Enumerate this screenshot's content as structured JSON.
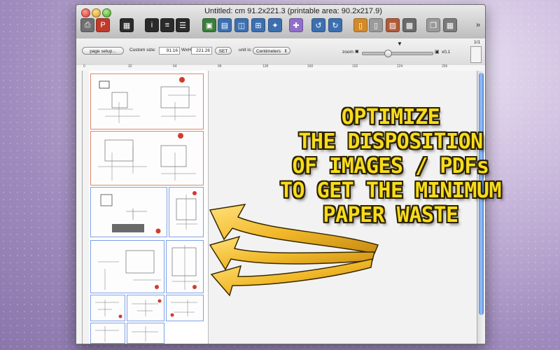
{
  "window": {
    "title": "Untitled: cm  91.2x221.3 (printable area: 90.2x217.9)",
    "page_counter": "1/1",
    "overflow": "»"
  },
  "toolbar": {
    "icons": [
      {
        "name": "print-icon",
        "glyph": "⎙",
        "color": "#6f6f6f"
      },
      {
        "name": "pdf-icon",
        "glyph": "P",
        "color": "#c0392b"
      },
      {
        "name": "grid-icon",
        "glyph": "▦",
        "color": "#2b2b2b"
      },
      {
        "name": "info-icon",
        "glyph": "i",
        "color": "#2a2a2a"
      },
      {
        "name": "sliders-icon",
        "glyph": "≡",
        "color": "#2a2a2a"
      },
      {
        "name": "list-icon",
        "glyph": "☰",
        "color": "#2a2a2a"
      },
      {
        "name": "image-add-icon",
        "glyph": "▣",
        "color": "#3b7d3a"
      },
      {
        "name": "image-icon",
        "glyph": "▤",
        "color": "#3c6fb0"
      },
      {
        "name": "window-icon",
        "glyph": "◫",
        "color": "#3c6fb0"
      },
      {
        "name": "arrange-icon",
        "glyph": "⊞",
        "color": "#3c6fb0"
      },
      {
        "name": "magic-icon",
        "glyph": "✦",
        "color": "#3c6fb0"
      },
      {
        "name": "stamp-icon",
        "glyph": "✚",
        "color": "#8f6fc9"
      },
      {
        "name": "rotate-left-icon",
        "glyph": "↺",
        "color": "#3c6fb0"
      },
      {
        "name": "rotate-right-icon",
        "glyph": "↻",
        "color": "#3c6fb0"
      },
      {
        "name": "document-icon",
        "glyph": "▯",
        "color": "#d28a2b"
      },
      {
        "name": "page-icon",
        "glyph": "▯",
        "color": "#9a9a9a"
      },
      {
        "name": "picture-icon",
        "glyph": "▨",
        "color": "#b05a3a"
      },
      {
        "name": "color-icon",
        "glyph": "▩",
        "color": "#6a6a6a"
      },
      {
        "name": "copy-icon",
        "glyph": "❐",
        "color": "#9a9a9a"
      },
      {
        "name": "calculator-icon",
        "glyph": "▦",
        "color": "#7a7a7a"
      }
    ]
  },
  "options": {
    "page_setup_label": "page setup...",
    "custom_size_label": "Custom size:",
    "width_value": "91.16",
    "wxh_label": "WxH",
    "height_value": "221.26",
    "set_label": "SET",
    "unit_label": "unit is:",
    "unit_value": "Centimeters",
    "zoom_label": "zoom",
    "zoom_value": "x0,1",
    "zoom_level": 0.35
  },
  "ruler": {
    "marks": [
      "0",
      "32",
      "64",
      "96",
      "128",
      "160",
      "192",
      "224",
      "256",
      "288"
    ]
  },
  "promo": {
    "lines": [
      "OPTIMIZE",
      "THE DISPOSITION",
      "OF IMAGES / PDFs",
      "TO GET THE MINIMUM",
      "PAPER WASTE"
    ]
  },
  "colors": {
    "promo_text": "#f7dc1c",
    "arrow": "#f1b92a",
    "thumb_border_red": "#e0876a",
    "thumb_border_blue": "#7ea1e6"
  }
}
